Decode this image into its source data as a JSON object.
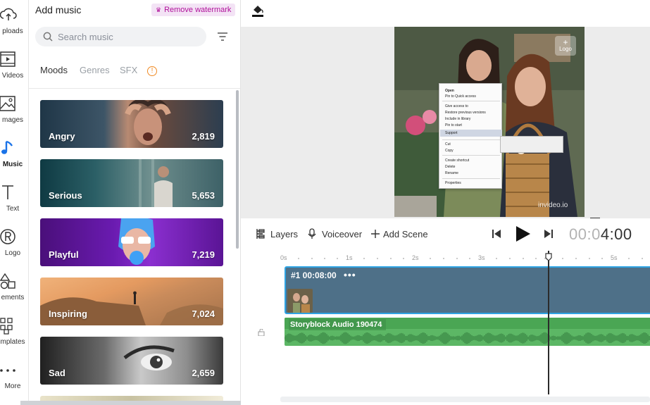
{
  "rail": {
    "items": [
      {
        "label": "ploads",
        "icon": "upload-cloud-icon"
      },
      {
        "label": "Videos",
        "icon": "video-icon"
      },
      {
        "label": "mages",
        "icon": "image-icon"
      },
      {
        "label": "Music",
        "icon": "music-note-icon"
      },
      {
        "label": "Text",
        "icon": "text-icon"
      },
      {
        "label": "Logo",
        "icon": "registered-logo-icon"
      },
      {
        "label": "ements",
        "icon": "shapes-icon"
      },
      {
        "label": "mplates",
        "icon": "templates-grid-icon"
      },
      {
        "label": "More",
        "icon": "more-dots-icon"
      }
    ],
    "active_index": 3
  },
  "panel": {
    "title": "Add music",
    "remove_watermark": "Remove watermark",
    "search_placeholder": "Search music",
    "tabs": [
      "Moods",
      "Genres",
      "SFX"
    ],
    "active_tab": "Moods",
    "moods": [
      {
        "name": "Angry",
        "count": "2,819"
      },
      {
        "name": "Serious",
        "count": "5,653"
      },
      {
        "name": "Playful",
        "count": "7,219"
      },
      {
        "name": "Inspiring",
        "count": "7,024"
      },
      {
        "name": "Sad",
        "count": "2,659"
      }
    ]
  },
  "preview": {
    "logo_badge": "Logo",
    "watermark": "invideo.io",
    "context_menu": [
      "Open",
      "Pin to Quick access",
      "Give access to",
      "Restore previous versions",
      "Include in library",
      "Pin to start",
      "Support",
      "Cut",
      "Copy",
      "Create shortcut",
      "Delete",
      "Rename",
      "Properties"
    ]
  },
  "toolbar": {
    "layers": "Layers",
    "voiceover": "Voiceover",
    "add_scene": "Add Scene",
    "timecode_dim": "00:0",
    "timecode_main": "4:00"
  },
  "timeline": {
    "ticks": [
      "0s",
      "1s",
      "2s",
      "3s",
      "4s",
      "5s"
    ],
    "scene_label": "#1  00:08:00",
    "scene_menu": "•••",
    "audio_title": "Storyblock Audio 190474"
  },
  "colors": {
    "accent": "#2fa4e3",
    "watermark_btn_bg": "#f3e3f5",
    "watermark_btn_text": "#b0109a",
    "scene_track": "#4e7088",
    "audio_track": "#5cb765",
    "info_icon": "#f08a24"
  }
}
